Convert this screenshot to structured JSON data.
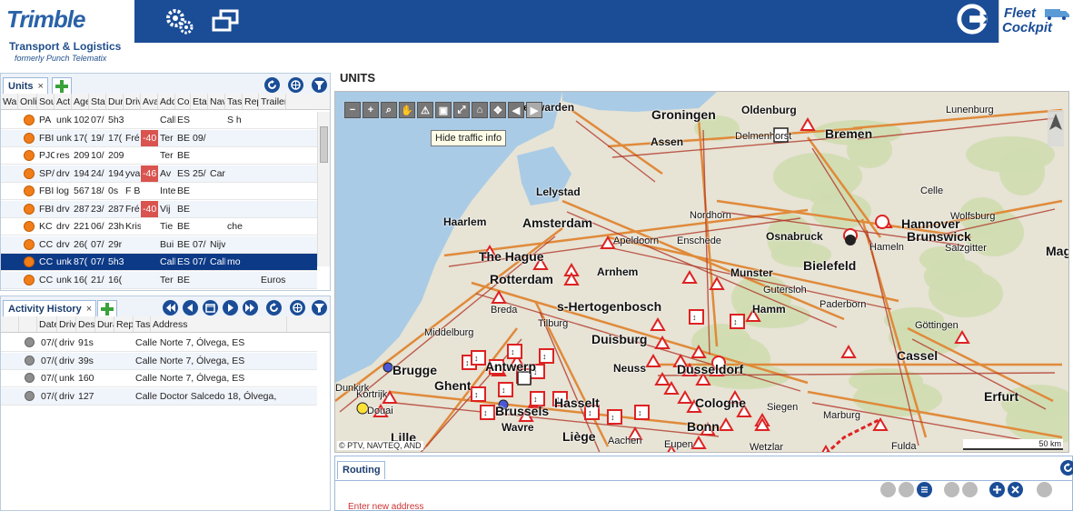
{
  "header": {
    "brand": "Trimble",
    "brand_sub1": "Transport & Logistics",
    "brand_sub2": "formerly Punch Telematix",
    "fleet_logo_1": "Fleet",
    "fleet_logo_2": "Cockpit",
    "icons": [
      "settings-gears-icon",
      "windows-icon",
      "logout-arrow-icon"
    ]
  },
  "units_panel": {
    "tab_label": "Units",
    "close_symbol": "×",
    "columns": [
      "War",
      "Onli",
      "Sou",
      "Act",
      "Age",
      "Star",
      "Dur",
      "Driv",
      "Ava",
      "Add",
      "Cou",
      "Eta",
      "Nav",
      "Tas",
      "Rep",
      "Trailer"
    ],
    "rows": [
      [
        "",
        "",
        "PA",
        "unk",
        "102",
        "07/",
        "5h3",
        "",
        "",
        "Call",
        "ES",
        "",
        "",
        "S h",
        "",
        ""
      ],
      [
        "",
        "",
        "FBI",
        "unk",
        "17(",
        "19/",
        "17(",
        "Fré",
        "-40",
        "Ter",
        "BE",
        "09/",
        "",
        "",
        "",
        ""
      ],
      [
        "",
        "",
        "PJC",
        "res",
        "209",
        "10/",
        "209",
        "",
        "",
        "Ter",
        "BE",
        "",
        "",
        "",
        "",
        ""
      ],
      [
        "",
        "",
        "SP/",
        "drv",
        "194",
        "24/",
        "194",
        "yva",
        "-46",
        "Av",
        "ES",
        "25/",
        "Car",
        "",
        "",
        ""
      ],
      [
        "",
        "",
        "FBI",
        "log",
        "567",
        "18/",
        "0s",
        "F B",
        "",
        "Inte",
        "BE",
        "",
        "",
        "",
        "",
        ""
      ],
      [
        "",
        "",
        "FBI",
        "drv",
        "287",
        "23/",
        "287",
        "Fré",
        "-40",
        "Vij",
        "BE",
        "",
        "",
        "",
        "",
        ""
      ],
      [
        "",
        "",
        "KC",
        "drv",
        "221",
        "06/",
        "23h",
        "Kris",
        "",
        "Tie",
        "BE",
        "",
        "",
        "che",
        "",
        ""
      ],
      [
        "",
        "",
        "CC",
        "drv",
        "26(",
        "07/",
        "29r",
        "",
        "",
        "Bui",
        "BE",
        "07/",
        "Nijv",
        "",
        "",
        ""
      ],
      [
        "",
        "",
        "CC",
        "unk",
        "87(",
        "07/",
        "5h3",
        "",
        "",
        "Call",
        "ES",
        "07/",
        "Call",
        "mo",
        "",
        ""
      ],
      [
        "",
        "",
        "CC",
        "unk",
        "16(",
        "21/",
        "16(",
        "",
        "",
        "Ter",
        "BE",
        "",
        "",
        "",
        "",
        "Euros"
      ]
    ],
    "selected_row": 8
  },
  "activity_panel": {
    "tab_label": "Activity History",
    "close_symbol": "×",
    "columns": [
      "",
      "",
      "Date",
      "Drivi",
      "Desc",
      "Dura",
      "Repo",
      "Tas",
      "Address"
    ],
    "rows": [
      [
        "07/(",
        "driv",
        "91s",
        "Calle Norte 7, Ólvega, ES"
      ],
      [
        "07/(",
        "driv",
        "39s",
        "Calle Norte 7, Ólvega, ES"
      ],
      [
        "07/(",
        "unk",
        "160",
        "Calle Norte 7, Ólvega, ES"
      ],
      [
        "07/(",
        "driv",
        "127",
        "Calle Doctor Salcedo 18, Ólvega,"
      ]
    ]
  },
  "map_panel": {
    "title": "UNITS",
    "tooltip": "Hide traffic info",
    "copyright": "© PTV, NAVTEQ, AND",
    "scale": "50 km",
    "cities": [
      {
        "name": "Leeuwarden",
        "cls": "",
        "icon": ""
      },
      {
        "name": "Groningen",
        "cls": "big",
        "icon": ""
      },
      {
        "name": "Oldenburg",
        "cls": "",
        "icon": ""
      },
      {
        "name": "Bremen",
        "cls": "big",
        "icon": ""
      },
      {
        "name": "Lunenburg",
        "cls": "sm",
        "icon": ""
      },
      {
        "name": "Delmenhorst",
        "cls": "sm",
        "icon": ""
      },
      {
        "name": "Assen",
        "cls": "",
        "icon": ""
      },
      {
        "name": "Lelystad",
        "cls": "",
        "icon": ""
      },
      {
        "name": "Celle",
        "cls": "sm",
        "icon": ""
      },
      {
        "name": "Haarlem",
        "cls": "",
        "icon": ""
      },
      {
        "name": "Amsterdam",
        "cls": "big",
        "icon": ""
      },
      {
        "name": "Nordhorn",
        "cls": "sm",
        "icon": ""
      },
      {
        "name": "Wolfsburg",
        "cls": "sm",
        "icon": ""
      },
      {
        "name": "Hannover",
        "cls": "big",
        "icon": ""
      },
      {
        "name": "Apeldoorn",
        "cls": "sm",
        "icon": ""
      },
      {
        "name": "Enschede",
        "cls": "sm",
        "icon": ""
      },
      {
        "name": "Osnabruck",
        "cls": "",
        "icon": ""
      },
      {
        "name": "Brunswick",
        "cls": "big",
        "icon": ""
      },
      {
        "name": "Hameln",
        "cls": "sm",
        "icon": ""
      },
      {
        "name": "Salzgitter",
        "cls": "sm",
        "icon": ""
      },
      {
        "name": "Mag",
        "cls": "big",
        "icon": ""
      },
      {
        "name": "The Hague",
        "cls": "big",
        "icon": ""
      },
      {
        "name": "Bielefeld",
        "cls": "big",
        "icon": ""
      },
      {
        "name": "Arnhem",
        "cls": "",
        "icon": ""
      },
      {
        "name": "Rotterdam",
        "cls": "big",
        "icon": ""
      },
      {
        "name": "Munster",
        "cls": "",
        "icon": ""
      },
      {
        "name": "Gutersloh",
        "cls": "sm",
        "icon": ""
      },
      {
        "name": "Breda",
        "cls": "sm",
        "icon": ""
      },
      {
        "name": "s-Hertogenbosch",
        "cls": "big",
        "icon": ""
      },
      {
        "name": "Paderborn",
        "cls": "sm",
        "icon": ""
      },
      {
        "name": "Hamm",
        "cls": "",
        "icon": ""
      },
      {
        "name": "Tilburg",
        "cls": "sm",
        "icon": ""
      },
      {
        "name": "Göttingen",
        "cls": "sm",
        "icon": ""
      },
      {
        "name": "Middelburg",
        "cls": "sm",
        "icon": ""
      },
      {
        "name": "Duisburg",
        "cls": "big",
        "icon": ""
      },
      {
        "name": "Cassel",
        "cls": "big",
        "icon": ""
      },
      {
        "name": "Brugge",
        "cls": "big",
        "icon": ""
      },
      {
        "name": "Antwerp",
        "cls": "big",
        "icon": ""
      },
      {
        "name": "Neuss",
        "cls": "",
        "icon": ""
      },
      {
        "name": "Dusseldorf",
        "cls": "big",
        "icon": ""
      },
      {
        "name": "Ghent",
        "cls": "big",
        "icon": ""
      },
      {
        "name": "Hasselt",
        "cls": "big",
        "icon": ""
      },
      {
        "name": "Cologne",
        "cls": "big",
        "icon": ""
      },
      {
        "name": "Siegen",
        "cls": "sm",
        "icon": ""
      },
      {
        "name": "Erfurt",
        "cls": "big",
        "icon": ""
      },
      {
        "name": "Brussels",
        "cls": "big",
        "icon": ""
      },
      {
        "name": "Wavre",
        "cls": "",
        "icon": ""
      },
      {
        "name": "Bonn",
        "cls": "big",
        "icon": ""
      },
      {
        "name": "Marburg",
        "cls": "sm",
        "icon": ""
      },
      {
        "name": "Kortrijk",
        "cls": "sm",
        "icon": ""
      },
      {
        "name": "Lille",
        "cls": "big",
        "icon": ""
      },
      {
        "name": "Liège",
        "cls": "big",
        "icon": ""
      },
      {
        "name": "Eupen",
        "cls": "sm",
        "icon": ""
      },
      {
        "name": "Aachen",
        "cls": "sm",
        "icon": ""
      },
      {
        "name": "Wetzlar",
        "cls": "sm",
        "icon": ""
      },
      {
        "name": "Fulda",
        "cls": "sm",
        "icon": ""
      },
      {
        "name": "Dunkirk",
        "cls": "sm",
        "icon": ""
      },
      {
        "name": "Douai",
        "cls": "sm",
        "icon": ""
      }
    ]
  },
  "routing_panel": {
    "tab_label": "Routing",
    "address_placeholder": "Enter new address"
  },
  "colors": {
    "header_bg": "#1b4d97",
    "accent": "#1b4d97",
    "selected_row": "#0d3a87",
    "warning": "#d9534f",
    "status_orange": "#f07d1a"
  }
}
